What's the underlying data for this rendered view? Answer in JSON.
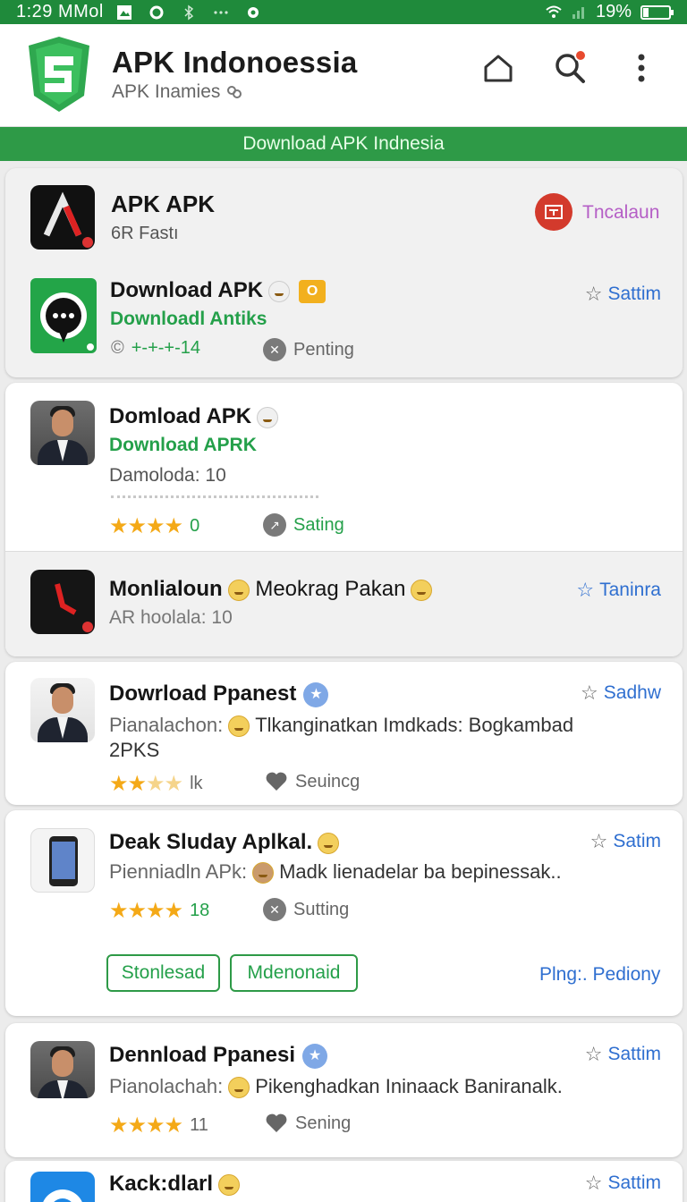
{
  "status_bar": {
    "time": "1:29 MMol",
    "battery": "19%",
    "battery_level": 0.19
  },
  "app_bar": {
    "title": "APK Indonoessia",
    "subtitle": "APK Inamies"
  },
  "banner": {
    "text": "Download APK Indnesia"
  },
  "items": [
    {
      "title": "APK APK",
      "sub": "6R Fastı",
      "action": "Tncalaun"
    },
    {
      "title": "Download APK",
      "badge": "O",
      "sub": "Downloadl Antiks",
      "meta": "+-+-+-14",
      "status": "Penting",
      "action": "Sattim"
    },
    {
      "title": "Domload APK",
      "sub": "Download  APRK",
      "detail": "Damoloda: 10",
      "rating_count": "0",
      "status": "Sating"
    },
    {
      "title": "Monlialoun",
      "title_extra": "Meokrag Pakan",
      "sub": "AR hoolala: 10",
      "action": "Taninra"
    },
    {
      "title": "Dowrload Ppanest",
      "sub": "Pianalachon:",
      "desc": "Tlkanginatkan Imdkads: Bogkambad",
      "desc2": "2PKS",
      "rating_count": "lk",
      "status": "Seuincg",
      "action": "Sadhw"
    },
    {
      "title": "Deak Sluday Aplkal.",
      "sub": "Pienniadln APk:",
      "desc": "Madk lienadelar ba bepinessak..",
      "rating_count": "18",
      "status": "Sutting",
      "action": "Satim",
      "btn1": "Stonlesad",
      "btn2": "Mdenonaid",
      "link": "Plng:. Pediony"
    },
    {
      "title": "Dennload Ppanesi",
      "sub": "Pianolachah:",
      "desc": "Pikenghadkan Ininaack Baniranalk.",
      "rating_count": "11",
      "status": "Sening",
      "action": "Sattim"
    },
    {
      "title": "Kack:dlarl",
      "action": "Sattim"
    }
  ],
  "colors": {
    "brand_green": "#1f8a3b",
    "accent_green": "#24a04a",
    "link_blue": "#2f6fd0",
    "star": "#f4a917"
  }
}
